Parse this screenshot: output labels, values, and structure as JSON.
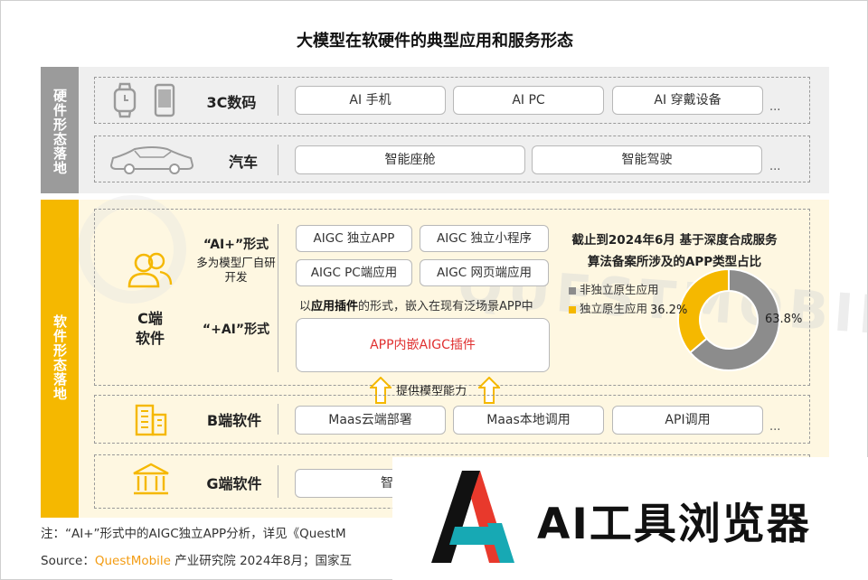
{
  "title": "大模型在软硬件的典型应用和服务形态",
  "watermark": "QUESTMOBILE",
  "hardware": {
    "side_label": "硬件形态落地",
    "rows": [
      {
        "label": "3C数码",
        "items": [
          "AI 手机",
          "AI PC",
          "AI 穿戴设备"
        ],
        "more": "..."
      },
      {
        "label": "汽车",
        "items": [
          "智能座舱",
          "智能驾驶"
        ],
        "more": "..."
      }
    ]
  },
  "software": {
    "side_label": "软件形态落地",
    "c_end": {
      "label_line1": "C端",
      "label_line2": "软件",
      "ai_plus_title": "“AI+”形式",
      "ai_plus_desc": "多为模型厂自研开发",
      "plus_ai_title": "“+AI”形式",
      "apps": [
        "AIGC 独立APP",
        "AIGC 独立小程序",
        "AIGC PC端应用",
        "AIGC 网页端应用"
      ],
      "plugin_note_prefix": "以",
      "plugin_note_bold": "应用插件",
      "plugin_note_suffix": "的形式，嵌入在现有泛场景APP中",
      "plugin_box": "APP内嵌AIGC插件"
    },
    "capability_label": "提供模型能力",
    "b_end": {
      "label": "B端软件",
      "items": [
        "Maas云端部署",
        "Maas本地调用",
        "API调用"
      ],
      "more": "..."
    },
    "g_end": {
      "label": "G端软件",
      "items": [
        "智"
      ]
    }
  },
  "chart_data": {
    "type": "pie",
    "title": "截止到2024年6月 基于深度合成服务算法备案所涉及的APP类型占比",
    "labels": [
      "非独立原生应用",
      "独立原生应用"
    ],
    "values": [
      63.8,
      36.2
    ],
    "value_labels": [
      "63.8%",
      "36.2%"
    ],
    "colors": [
      "#8c8c8c",
      "#f5b800"
    ],
    "donut": true,
    "legend": "left"
  },
  "footer": {
    "note": "注：“AI+”形式中的AIGC独立APP分析，详见《QuestM",
    "source_prefix": "Source：",
    "source_brand": "QuestMobile",
    "source_suffix": " 产业研究院 2024年8月；国家互"
  },
  "overlay_brand": "AI工具浏览器",
  "colors": {
    "accent": "#f5b800",
    "hw_side": "#9b9b9b",
    "red": "#e03030",
    "overlay_red": "#e8392c",
    "overlay_teal": "#17a9b4"
  }
}
